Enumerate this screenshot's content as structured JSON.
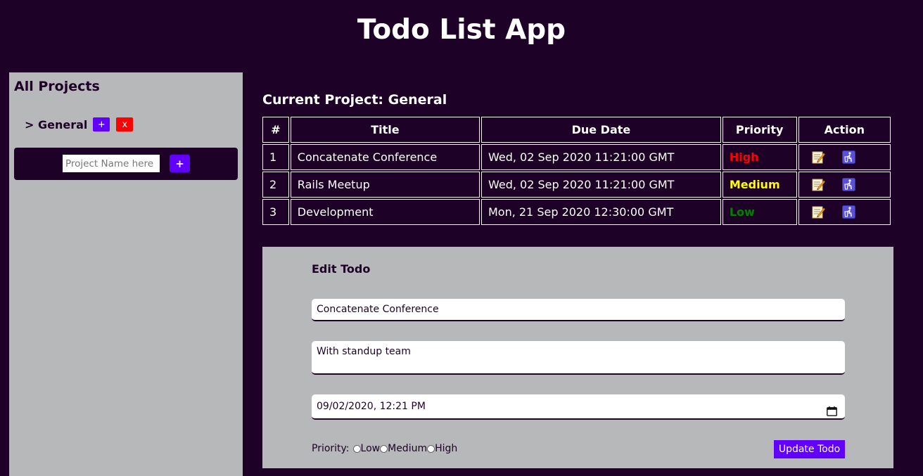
{
  "app": {
    "title": "Todo List App"
  },
  "sidebar": {
    "heading": "All Projects",
    "projects": [
      {
        "label": "> General",
        "add_label": "+",
        "delete_label": "x"
      }
    ],
    "new_project": {
      "placeholder": "Project Name here",
      "value": "",
      "add_label": "+"
    }
  },
  "main": {
    "current_project_label": "Current Project: General",
    "table": {
      "headers": [
        "#",
        "Title",
        "Due Date",
        "Priority",
        "Action"
      ],
      "rows": [
        {
          "num": "1",
          "title": "Concatenate Conference",
          "due": "Wed, 02 Sep 2020 11:21:00 GMT",
          "priority": "High",
          "priority_color": "#ff0000"
        },
        {
          "num": "2",
          "title": "Rails Meetup",
          "due": "Wed, 02 Sep 2020 11:21:00 GMT",
          "priority": "Medium",
          "priority_color": "#ffff00"
        },
        {
          "num": "3",
          "title": "Development",
          "due": "Mon, 21 Sep 2020 12:30:00 GMT",
          "priority": "Low",
          "priority_color": "#008000"
        }
      ],
      "action_icons": [
        "edit-icon",
        "trash-icon"
      ]
    }
  },
  "edit_form": {
    "heading": "Edit Todo",
    "title_value": "Concatenate Conference",
    "description_value": "With standup team",
    "datetime_value": "09/02/2020, 12:21 PM",
    "priority_label": "Priority:",
    "priority_options": [
      "Low",
      "Medium",
      "High"
    ],
    "submit_label": "Update Todo"
  },
  "colors": {
    "background": "#1e0127",
    "panel": "#b7b8ba",
    "accent": "#6200ff",
    "danger": "#ff0000"
  }
}
